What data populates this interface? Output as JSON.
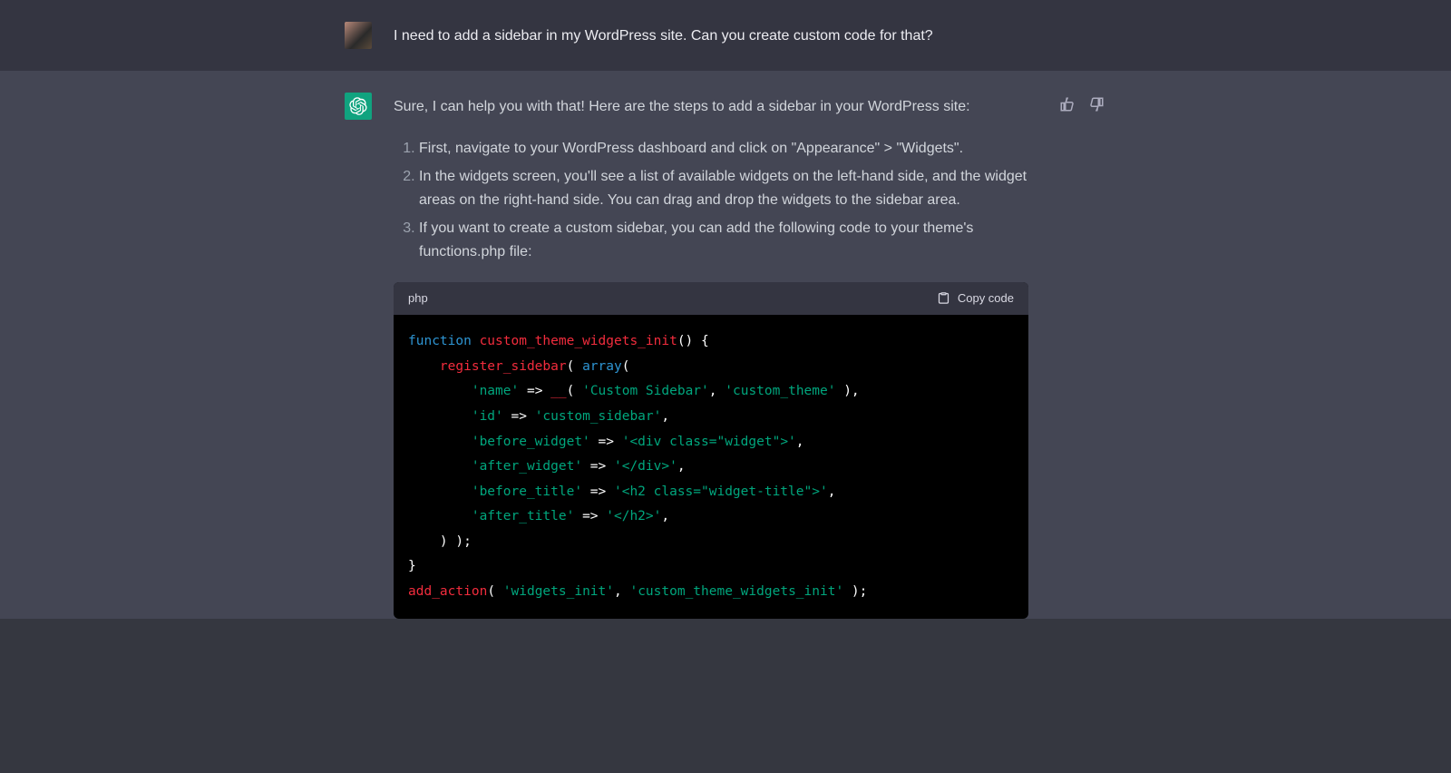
{
  "user": {
    "message": "I need to add a sidebar in my WordPress site. Can you create custom code for that?"
  },
  "assistant": {
    "intro": "Sure, I can help you with that! Here are the steps to add a sidebar in your WordPress site:",
    "steps": [
      "First, navigate to your WordPress dashboard and click on \"Appearance\" > \"Widgets\".",
      "In the widgets screen, you'll see a list of available widgets on the left-hand side, and the widget areas on the right-hand side. You can drag and drop the widgets to the sidebar area.",
      "If you want to create a custom sidebar, you can add the following code to your theme's functions.php file:"
    ],
    "code": {
      "lang": "php",
      "copy_label": "Copy code",
      "raw": "function custom_theme_widgets_init() {\n    register_sidebar( array(\n        'name' => __( 'Custom Sidebar', 'custom_theme' ),\n        'id' => 'custom_sidebar',\n        'before_widget' => '<div class=\"widget\">',\n        'after_widget' => '</div>',\n        'before_title' => '<h2 class=\"widget-title\">',\n        'after_title' => '</h2>',\n    ) );\n}\nadd_action( 'widgets_init', 'custom_theme_widgets_init' );",
      "tokens": [
        [
          [
            "function",
            "kw"
          ],
          [
            " ",
            "pun"
          ],
          [
            "custom_theme_widgets_init",
            "fn"
          ],
          [
            "() {",
            "pun"
          ]
        ],
        [
          [
            "    ",
            "pun"
          ],
          [
            "register_sidebar",
            "fn"
          ],
          [
            "( ",
            "pun"
          ],
          [
            "array",
            "arr"
          ],
          [
            "(",
            "pun"
          ]
        ],
        [
          [
            "        ",
            "pun"
          ],
          [
            "'name'",
            "str"
          ],
          [
            " => ",
            "pun"
          ],
          [
            "__",
            "fn"
          ],
          [
            "( ",
            "pun"
          ],
          [
            "'Custom Sidebar'",
            "str"
          ],
          [
            ", ",
            "pun"
          ],
          [
            "'custom_theme'",
            "str"
          ],
          [
            " ),",
            "pun"
          ]
        ],
        [
          [
            "        ",
            "pun"
          ],
          [
            "'id'",
            "str"
          ],
          [
            " => ",
            "pun"
          ],
          [
            "'custom_sidebar'",
            "str"
          ],
          [
            ",",
            "pun"
          ]
        ],
        [
          [
            "        ",
            "pun"
          ],
          [
            "'before_widget'",
            "str"
          ],
          [
            " => ",
            "pun"
          ],
          [
            "'<div class=\"widget\">'",
            "str"
          ],
          [
            ",",
            "pun"
          ]
        ],
        [
          [
            "        ",
            "pun"
          ],
          [
            "'after_widget'",
            "str"
          ],
          [
            " => ",
            "pun"
          ],
          [
            "'</div>'",
            "str"
          ],
          [
            ",",
            "pun"
          ]
        ],
        [
          [
            "        ",
            "pun"
          ],
          [
            "'before_title'",
            "str"
          ],
          [
            " => ",
            "pun"
          ],
          [
            "'<h2 class=\"widget-title\">'",
            "str"
          ],
          [
            ",",
            "pun"
          ]
        ],
        [
          [
            "        ",
            "pun"
          ],
          [
            "'after_title'",
            "str"
          ],
          [
            " => ",
            "pun"
          ],
          [
            "'</h2>'",
            "str"
          ],
          [
            ",",
            "pun"
          ]
        ],
        [
          [
            "    ) );",
            "pun"
          ]
        ],
        [
          [
            "}",
            "pun"
          ]
        ],
        [
          [
            "add_action",
            "fn"
          ],
          [
            "( ",
            "pun"
          ],
          [
            "'widgets_init'",
            "str"
          ],
          [
            ", ",
            "pun"
          ],
          [
            "'custom_theme_widgets_init'",
            "str"
          ],
          [
            " );",
            "pun"
          ]
        ]
      ]
    }
  },
  "feedback": {
    "thumbs_up": "thumbs-up",
    "thumbs_down": "thumbs-down"
  }
}
